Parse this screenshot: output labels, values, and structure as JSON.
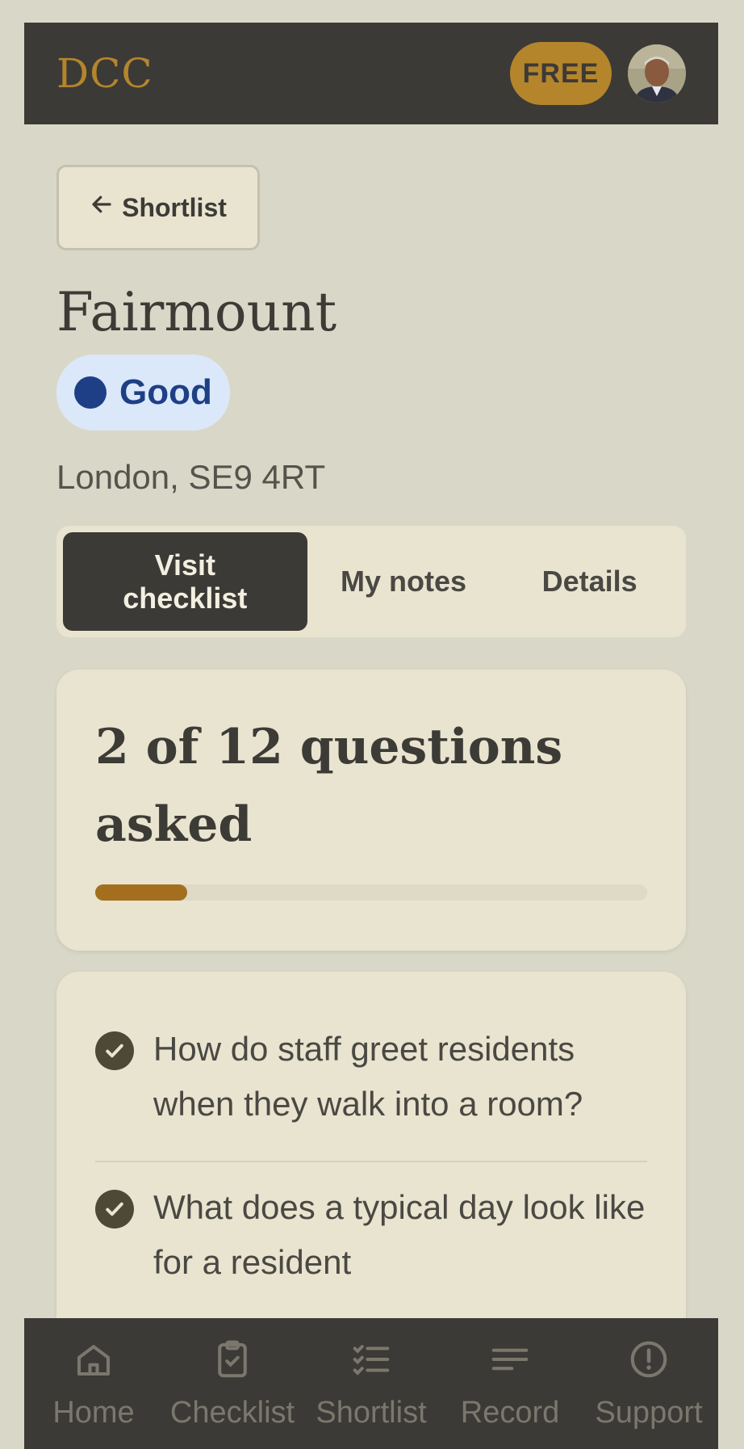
{
  "header": {
    "logo": "DCC",
    "plan_badge": "FREE"
  },
  "back_button": {
    "label": "Shortlist",
    "icon": "arrow-left-icon"
  },
  "home": {
    "name": "Fairmount",
    "rating": "Good",
    "rating_color": "#1e3f86",
    "address": "London, SE9 4RT"
  },
  "tabs": [
    {
      "label": "Visit checklist",
      "active": true
    },
    {
      "label": "My notes",
      "active": false
    },
    {
      "label": "Details",
      "active": false
    }
  ],
  "progress": {
    "title": "2 of 12 questions asked",
    "asked": 2,
    "total": 12
  },
  "questions": [
    {
      "text": "How do staff greet residents when they walk into a room?",
      "checked": true
    },
    {
      "text": "What does a typical day look like for a resident",
      "checked": true
    }
  ],
  "bottom_nav": [
    {
      "label": "Home",
      "icon": "home-icon"
    },
    {
      "label": "Checklist",
      "icon": "clipboard-check-icon"
    },
    {
      "label": "Shortlist",
      "icon": "list-check-icon"
    },
    {
      "label": "Record",
      "icon": "lines-icon"
    },
    {
      "label": "Support",
      "icon": "alert-circle-icon"
    }
  ],
  "colors": {
    "accent": "#b5852c",
    "dark": "#3c3a36",
    "progress": "#a36f1f"
  }
}
